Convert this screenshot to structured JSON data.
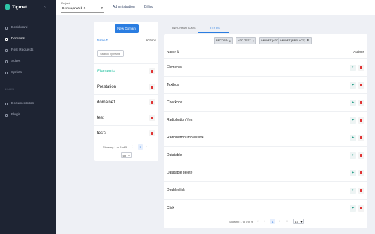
{
  "app": {
    "name": "Tigmat",
    "collapse_glyph": "‹"
  },
  "sidebar": {
    "items": [
      {
        "label": "Dashboard",
        "icon": "dashboard-icon"
      },
      {
        "label": "Domains",
        "icon": "domains-icon",
        "active": true
      },
      {
        "label": "Rest Requests",
        "icon": "rest-requests-icon"
      },
      {
        "label": "Suites",
        "icon": "suites-icon"
      },
      {
        "label": "Sprints",
        "icon": "sprints-icon"
      }
    ],
    "section_label": "LINKS",
    "links": [
      {
        "label": "Documentation",
        "icon": "documentation-icon"
      },
      {
        "label": "Plugin",
        "icon": "plugin-icon"
      }
    ]
  },
  "topbar": {
    "project_label": "Project",
    "project_value": "Demoqa Web 2",
    "administration": "Administration",
    "billing": "Billing"
  },
  "domains": {
    "new_button": "New Domain",
    "col_name": "Name",
    "sort_glyph": "⇅",
    "col_actions": "Actions",
    "search_placeholder": "Search by name",
    "rows": [
      {
        "name": "Elements",
        "selected": true
      },
      {
        "name": "Prestation"
      },
      {
        "name": "domaine1"
      },
      {
        "name": "test"
      },
      {
        "name": "test2"
      }
    ],
    "pagination": {
      "text": "Showing 1 to 5 of 5",
      "page": "1",
      "per_page": "50",
      "prev": "‹",
      "next": "›"
    }
  },
  "tabs": {
    "informations": "INFORMATIONS",
    "tests": "TESTS"
  },
  "tests": {
    "toolbar": [
      {
        "label": "RECORD",
        "icon": "●"
      },
      {
        "label": "ADD TEST",
        "icon": "+"
      },
      {
        "label": "IMPORT (ADD)",
        "icon": "⇅"
      },
      {
        "label": "IMPORT (REPLACE)",
        "icon": "⬇"
      }
    ],
    "col_name": "Name",
    "sort_glyph": "⇅",
    "col_actions": "Actions",
    "rows": [
      {
        "name": "Elements"
      },
      {
        "name": "Textbox"
      },
      {
        "name": "Checkbox"
      },
      {
        "name": "Radiobutton Yes"
      },
      {
        "name": "Radiobutton Impressive"
      },
      {
        "name": "Datatable"
      },
      {
        "name": "Datatable delete"
      },
      {
        "name": "Doubleclick"
      },
      {
        "name": "Click"
      }
    ],
    "pagination": {
      "text": "Showing 1 to 9 of 9",
      "first": "«",
      "prev": "‹",
      "page": "1",
      "next": "›",
      "last": "»",
      "per_page": "10"
    }
  },
  "colors": {
    "accent": "#2a7de1",
    "sidebar_bg": "#1e2433",
    "selected_domain": "#2ec4a6",
    "delete": "#e03232"
  }
}
